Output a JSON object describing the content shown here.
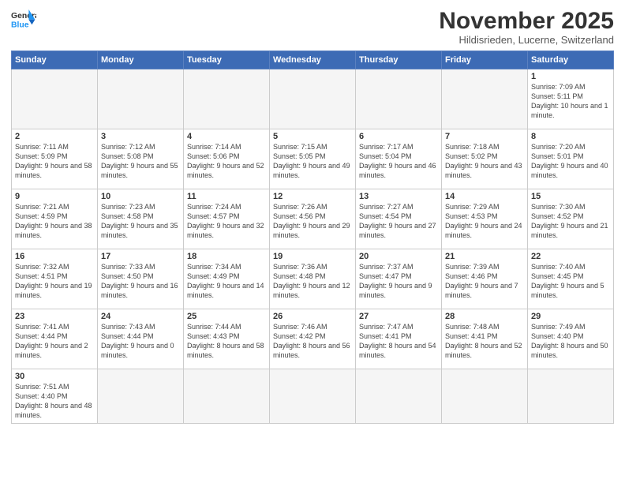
{
  "header": {
    "logo_general": "General",
    "logo_blue": "Blue",
    "month_title": "November 2025",
    "location": "Hildisrieden, Lucerne, Switzerland"
  },
  "days_of_week": [
    "Sunday",
    "Monday",
    "Tuesday",
    "Wednesday",
    "Thursday",
    "Friday",
    "Saturday"
  ],
  "weeks": [
    [
      {
        "day": "",
        "info": ""
      },
      {
        "day": "",
        "info": ""
      },
      {
        "day": "",
        "info": ""
      },
      {
        "day": "",
        "info": ""
      },
      {
        "day": "",
        "info": ""
      },
      {
        "day": "",
        "info": ""
      },
      {
        "day": "1",
        "info": "Sunrise: 7:09 AM\nSunset: 5:11 PM\nDaylight: 10 hours\nand 1 minute."
      }
    ],
    [
      {
        "day": "2",
        "info": "Sunrise: 7:11 AM\nSunset: 5:09 PM\nDaylight: 9 hours\nand 58 minutes."
      },
      {
        "day": "3",
        "info": "Sunrise: 7:12 AM\nSunset: 5:08 PM\nDaylight: 9 hours\nand 55 minutes."
      },
      {
        "day": "4",
        "info": "Sunrise: 7:14 AM\nSunset: 5:06 PM\nDaylight: 9 hours\nand 52 minutes."
      },
      {
        "day": "5",
        "info": "Sunrise: 7:15 AM\nSunset: 5:05 PM\nDaylight: 9 hours\nand 49 minutes."
      },
      {
        "day": "6",
        "info": "Sunrise: 7:17 AM\nSunset: 5:04 PM\nDaylight: 9 hours\nand 46 minutes."
      },
      {
        "day": "7",
        "info": "Sunrise: 7:18 AM\nSunset: 5:02 PM\nDaylight: 9 hours\nand 43 minutes."
      },
      {
        "day": "8",
        "info": "Sunrise: 7:20 AM\nSunset: 5:01 PM\nDaylight: 9 hours\nand 40 minutes."
      }
    ],
    [
      {
        "day": "9",
        "info": "Sunrise: 7:21 AM\nSunset: 4:59 PM\nDaylight: 9 hours\nand 38 minutes."
      },
      {
        "day": "10",
        "info": "Sunrise: 7:23 AM\nSunset: 4:58 PM\nDaylight: 9 hours\nand 35 minutes."
      },
      {
        "day": "11",
        "info": "Sunrise: 7:24 AM\nSunset: 4:57 PM\nDaylight: 9 hours\nand 32 minutes."
      },
      {
        "day": "12",
        "info": "Sunrise: 7:26 AM\nSunset: 4:56 PM\nDaylight: 9 hours\nand 29 minutes."
      },
      {
        "day": "13",
        "info": "Sunrise: 7:27 AM\nSunset: 4:54 PM\nDaylight: 9 hours\nand 27 minutes."
      },
      {
        "day": "14",
        "info": "Sunrise: 7:29 AM\nSunset: 4:53 PM\nDaylight: 9 hours\nand 24 minutes."
      },
      {
        "day": "15",
        "info": "Sunrise: 7:30 AM\nSunset: 4:52 PM\nDaylight: 9 hours\nand 21 minutes."
      }
    ],
    [
      {
        "day": "16",
        "info": "Sunrise: 7:32 AM\nSunset: 4:51 PM\nDaylight: 9 hours\nand 19 minutes."
      },
      {
        "day": "17",
        "info": "Sunrise: 7:33 AM\nSunset: 4:50 PM\nDaylight: 9 hours\nand 16 minutes."
      },
      {
        "day": "18",
        "info": "Sunrise: 7:34 AM\nSunset: 4:49 PM\nDaylight: 9 hours\nand 14 minutes."
      },
      {
        "day": "19",
        "info": "Sunrise: 7:36 AM\nSunset: 4:48 PM\nDaylight: 9 hours\nand 12 minutes."
      },
      {
        "day": "20",
        "info": "Sunrise: 7:37 AM\nSunset: 4:47 PM\nDaylight: 9 hours\nand 9 minutes."
      },
      {
        "day": "21",
        "info": "Sunrise: 7:39 AM\nSunset: 4:46 PM\nDaylight: 9 hours\nand 7 minutes."
      },
      {
        "day": "22",
        "info": "Sunrise: 7:40 AM\nSunset: 4:45 PM\nDaylight: 9 hours\nand 5 minutes."
      }
    ],
    [
      {
        "day": "23",
        "info": "Sunrise: 7:41 AM\nSunset: 4:44 PM\nDaylight: 9 hours\nand 2 minutes."
      },
      {
        "day": "24",
        "info": "Sunrise: 7:43 AM\nSunset: 4:44 PM\nDaylight: 9 hours\nand 0 minutes."
      },
      {
        "day": "25",
        "info": "Sunrise: 7:44 AM\nSunset: 4:43 PM\nDaylight: 8 hours\nand 58 minutes."
      },
      {
        "day": "26",
        "info": "Sunrise: 7:46 AM\nSunset: 4:42 PM\nDaylight: 8 hours\nand 56 minutes."
      },
      {
        "day": "27",
        "info": "Sunrise: 7:47 AM\nSunset: 4:41 PM\nDaylight: 8 hours\nand 54 minutes."
      },
      {
        "day": "28",
        "info": "Sunrise: 7:48 AM\nSunset: 4:41 PM\nDaylight: 8 hours\nand 52 minutes."
      },
      {
        "day": "29",
        "info": "Sunrise: 7:49 AM\nSunset: 4:40 PM\nDaylight: 8 hours\nand 50 minutes."
      }
    ],
    [
      {
        "day": "30",
        "info": "Sunrise: 7:51 AM\nSunset: 4:40 PM\nDaylight: 8 hours\nand 48 minutes."
      },
      {
        "day": "",
        "info": ""
      },
      {
        "day": "",
        "info": ""
      },
      {
        "day": "",
        "info": ""
      },
      {
        "day": "",
        "info": ""
      },
      {
        "day": "",
        "info": ""
      },
      {
        "day": "",
        "info": ""
      }
    ]
  ]
}
